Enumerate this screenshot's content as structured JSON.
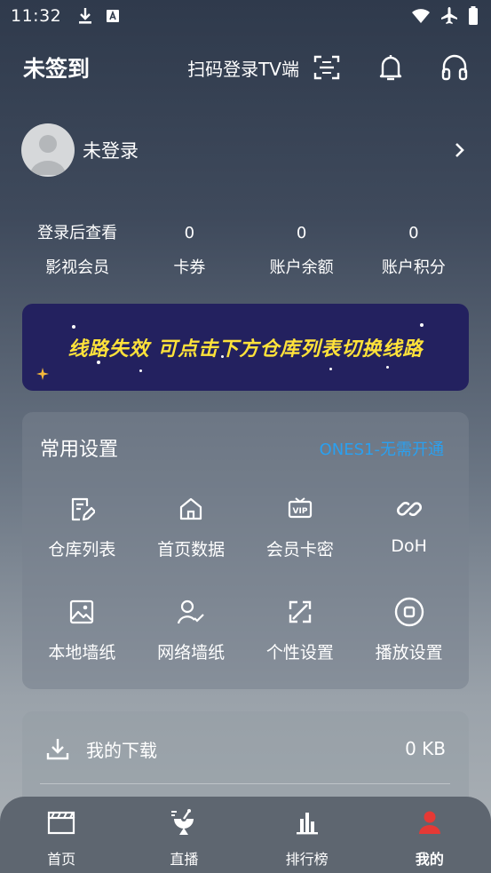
{
  "status_bar": {
    "time": "11:32",
    "icons": [
      "download-icon",
      "font-a-icon",
      "wifi-icon",
      "airplane-icon",
      "battery-icon"
    ]
  },
  "header": {
    "sign_status": "未签到",
    "scan_label": "扫码登录TV端",
    "icons": [
      "scan-icon",
      "bell-icon",
      "headset-icon"
    ]
  },
  "profile": {
    "name": "未登录"
  },
  "stats": [
    {
      "value": "登录后查看",
      "label": "影视会员"
    },
    {
      "value": "0",
      "label": "卡券"
    },
    {
      "value": "0",
      "label": "账户余额"
    },
    {
      "value": "0",
      "label": "账户积分"
    }
  ],
  "banner": {
    "text": "线路失效  可点击下方仓库列表切换线路",
    "text_color": "#ffe23a",
    "bg_color": "#23215f"
  },
  "settings": {
    "title": "常用设置",
    "note": "ONES1-无需开通",
    "note_color": "#2aa0f0",
    "items": [
      {
        "label": "仓库列表",
        "icon": "edit-doc-icon"
      },
      {
        "label": "首页数据",
        "icon": "home-icon"
      },
      {
        "label": "会员卡密",
        "icon": "vip-icon"
      },
      {
        "label": "DoH",
        "icon": "link-icon"
      },
      {
        "label": "本地墙纸",
        "icon": "image-icon"
      },
      {
        "label": "网络墙纸",
        "icon": "user-check-icon"
      },
      {
        "label": "个性设置",
        "icon": "expand-icon"
      },
      {
        "label": "播放设置",
        "icon": "stop-circle-icon"
      }
    ]
  },
  "downloads": {
    "label": "我的下载",
    "size": "0 KB"
  },
  "bottom_nav": {
    "items": [
      {
        "label": "首页",
        "icon": "clapperboard-icon"
      },
      {
        "label": "直播",
        "icon": "satellite-icon"
      },
      {
        "label": "排行榜",
        "icon": "bar-chart-icon"
      },
      {
        "label": "我的",
        "icon": "person-icon"
      }
    ],
    "active_index": 3,
    "active_color": "#e53935"
  }
}
